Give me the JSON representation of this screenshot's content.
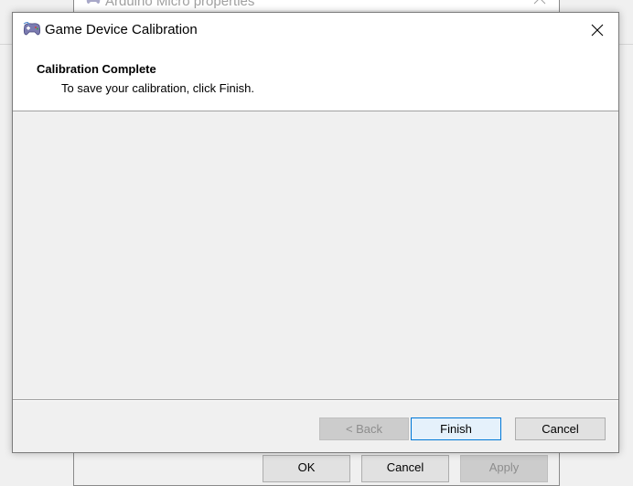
{
  "background_window": {
    "title": "Arduino Micro properties",
    "buttons": [
      {
        "label": "OK",
        "enabled": true
      },
      {
        "label": "Cancel",
        "enabled": true
      },
      {
        "label": "Apply",
        "enabled": false
      }
    ]
  },
  "dialog": {
    "title": "Game Device Calibration",
    "icon": "game-controller-icon",
    "close_icon": "close-icon"
  },
  "header": {
    "title": "Calibration Complete",
    "subtitle": "To save your calibration, click Finish."
  },
  "footer": {
    "back_label": "< Back",
    "finish_label": "Finish",
    "cancel_label": "Cancel"
  },
  "colors": {
    "accent": "#0078d7",
    "window_bg": "#f0f0f0",
    "panel_bg": "#ffffff"
  }
}
